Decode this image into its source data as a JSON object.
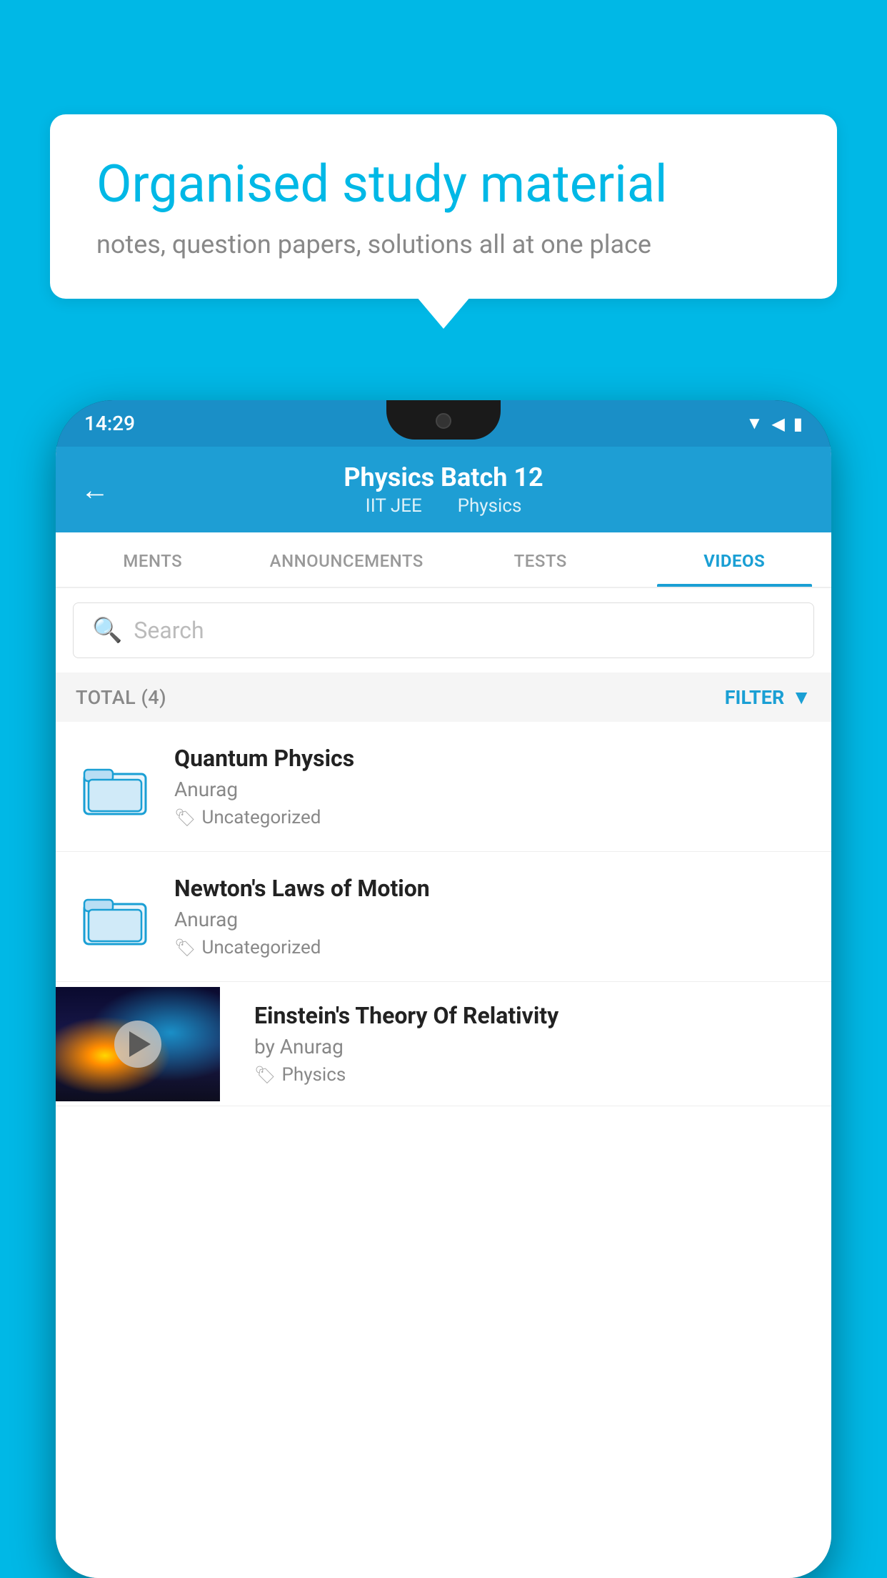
{
  "background_color": "#00b8e6",
  "speech_bubble": {
    "heading": "Organised study material",
    "subtext": "notes, question papers, solutions all at one place"
  },
  "status_bar": {
    "time": "14:29",
    "icons": [
      "wifi",
      "signal",
      "battery"
    ]
  },
  "app_header": {
    "back_label": "←",
    "title": "Physics Batch 12",
    "subtitle_parts": [
      "IIT JEE",
      "Physics"
    ]
  },
  "tabs": [
    {
      "label": "MENTS",
      "active": false
    },
    {
      "label": "ANNOUNCEMENTS",
      "active": false
    },
    {
      "label": "TESTS",
      "active": false
    },
    {
      "label": "VIDEOS",
      "active": true
    }
  ],
  "search": {
    "placeholder": "Search"
  },
  "filter_row": {
    "total_label": "TOTAL (4)",
    "filter_label": "FILTER"
  },
  "videos": [
    {
      "title": "Quantum Physics",
      "author": "Anurag",
      "tag": "Uncategorized",
      "has_thumbnail": false
    },
    {
      "title": "Newton's Laws of Motion",
      "author": "Anurag",
      "tag": "Uncategorized",
      "has_thumbnail": false
    },
    {
      "title": "Einstein's Theory Of Relativity",
      "author": "by Anurag",
      "tag": "Physics",
      "has_thumbnail": true
    }
  ]
}
